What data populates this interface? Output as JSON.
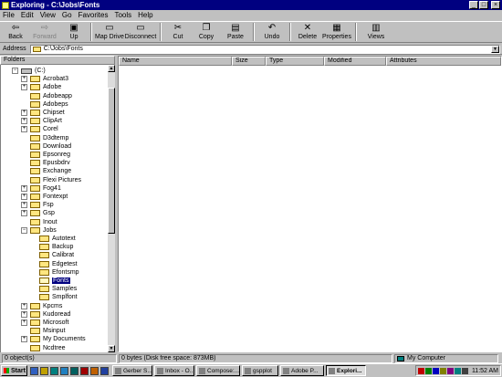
{
  "window": {
    "title": "Exploring - C:\\Jobs\\Fonts",
    "min_glyph": "_",
    "max_glyph": "□",
    "close_glyph": "×"
  },
  "menu": [
    "File",
    "Edit",
    "View",
    "Go",
    "Favorites",
    "Tools",
    "Help"
  ],
  "toolbar": [
    {
      "label": "Back",
      "icon": "back-arrow-icon",
      "glyph": "⇦",
      "disabled": false,
      "dropdown": true
    },
    {
      "label": "Forward",
      "icon": "forward-arrow-icon",
      "glyph": "⇨",
      "disabled": true,
      "dropdown": true
    },
    {
      "label": "Up",
      "icon": "up-folder-icon",
      "glyph": "▣",
      "disabled": false
    },
    {
      "label": "Map Drive",
      "icon": "map-drive-icon",
      "glyph": "▭",
      "disabled": false
    },
    {
      "label": "Disconnect",
      "icon": "disconnect-icon",
      "glyph": "▭",
      "disabled": false
    },
    {
      "label": "Cut",
      "icon": "scissors-icon",
      "glyph": "✂",
      "disabled": false
    },
    {
      "label": "Copy",
      "icon": "copy-icon",
      "glyph": "❐",
      "disabled": false
    },
    {
      "label": "Paste",
      "icon": "paste-icon",
      "glyph": "▤",
      "disabled": false
    },
    {
      "label": "Undo",
      "icon": "undo-icon",
      "glyph": "↶",
      "disabled": false
    },
    {
      "label": "Delete",
      "icon": "delete-icon",
      "glyph": "✕",
      "disabled": false
    },
    {
      "label": "Properties",
      "icon": "properties-icon",
      "glyph": "▦",
      "disabled": false
    },
    {
      "label": "Views",
      "icon": "views-icon",
      "glyph": "▥",
      "disabled": false,
      "dropdown": true
    }
  ],
  "address": {
    "label": "Address",
    "value": "C:\\Jobs\\Fonts"
  },
  "folders_header": "Folders",
  "tree": [
    {
      "label": "(C:)",
      "level": 0,
      "expander": "-",
      "kind": "drive"
    },
    {
      "label": "Acrobat3",
      "level": 1,
      "expander": "+"
    },
    {
      "label": "Adobe",
      "level": 1,
      "expander": "+"
    },
    {
      "label": "Adobeapp",
      "level": 1,
      "expander": ""
    },
    {
      "label": "Adobeps",
      "level": 1,
      "expander": ""
    },
    {
      "label": "Chipset",
      "level": 1,
      "expander": "+"
    },
    {
      "label": "ClipArt",
      "level": 1,
      "expander": "+"
    },
    {
      "label": "Corel",
      "level": 1,
      "expander": "+"
    },
    {
      "label": "D3dtemp",
      "level": 1,
      "expander": ""
    },
    {
      "label": "Download",
      "level": 1,
      "expander": ""
    },
    {
      "label": "Epsonreg",
      "level": 1,
      "expander": ""
    },
    {
      "label": "Epusbdrv",
      "level": 1,
      "expander": ""
    },
    {
      "label": "Exchange",
      "level": 1,
      "expander": ""
    },
    {
      "label": "Flexi Pictures",
      "level": 1,
      "expander": ""
    },
    {
      "label": "Fog41",
      "level": 1,
      "expander": "+"
    },
    {
      "label": "Fontexpt",
      "level": 1,
      "expander": "+"
    },
    {
      "label": "Fsp",
      "level": 1,
      "expander": "+"
    },
    {
      "label": "Gsp",
      "level": 1,
      "expander": "+"
    },
    {
      "label": "Inout",
      "level": 1,
      "expander": ""
    },
    {
      "label": "Jobs",
      "level": 1,
      "expander": "-"
    },
    {
      "label": "Autotext",
      "level": 2,
      "expander": ""
    },
    {
      "label": "Backup",
      "level": 2,
      "expander": ""
    },
    {
      "label": "Calibrat",
      "level": 2,
      "expander": ""
    },
    {
      "label": "Edgetest",
      "level": 2,
      "expander": ""
    },
    {
      "label": "Efontsmp",
      "level": 2,
      "expander": ""
    },
    {
      "label": "Fonts",
      "level": 2,
      "expander": "",
      "selected": true
    },
    {
      "label": "Samples",
      "level": 2,
      "expander": ""
    },
    {
      "label": "Smplfont",
      "level": 2,
      "expander": ""
    },
    {
      "label": "Kpcms",
      "level": 1,
      "expander": "+"
    },
    {
      "label": "Kudoread",
      "level": 1,
      "expander": "+"
    },
    {
      "label": "Microsoft",
      "level": 1,
      "expander": "+"
    },
    {
      "label": "Msinput",
      "level": 1,
      "expander": ""
    },
    {
      "label": "My Documents",
      "level": 1,
      "expander": "+"
    },
    {
      "label": "Ncdtree",
      "level": 1,
      "expander": ""
    }
  ],
  "columns": [
    "Name",
    "Size",
    "Type",
    "Modified",
    "Attributes"
  ],
  "status": {
    "objects": "0 object(s)",
    "disk": "0 bytes (Disk free space: 873MB)",
    "location": "My Computer"
  },
  "taskbar": {
    "start_label": "Start",
    "quick_launch": [
      "ie-icon",
      "outlook-icon",
      "desktop-icon",
      "channels-icon",
      "netscape-icon",
      "app-icon",
      "photo-icon",
      "word-icon"
    ],
    "tasks": [
      {
        "label": "Gerber S...",
        "active": false
      },
      {
        "label": "Inbox - O...",
        "active": false
      },
      {
        "label": "Compose:...",
        "active": false
      },
      {
        "label": "gspplot",
        "active": false
      },
      {
        "label": "Adobe P...",
        "active": false
      },
      {
        "label": "Explori...",
        "active": true
      }
    ],
    "clock": "11:52 AM"
  },
  "colors": {
    "title_bg": "#000080",
    "face": "#c0c0c0",
    "folder": "#ffe680",
    "selection": "#000080"
  }
}
